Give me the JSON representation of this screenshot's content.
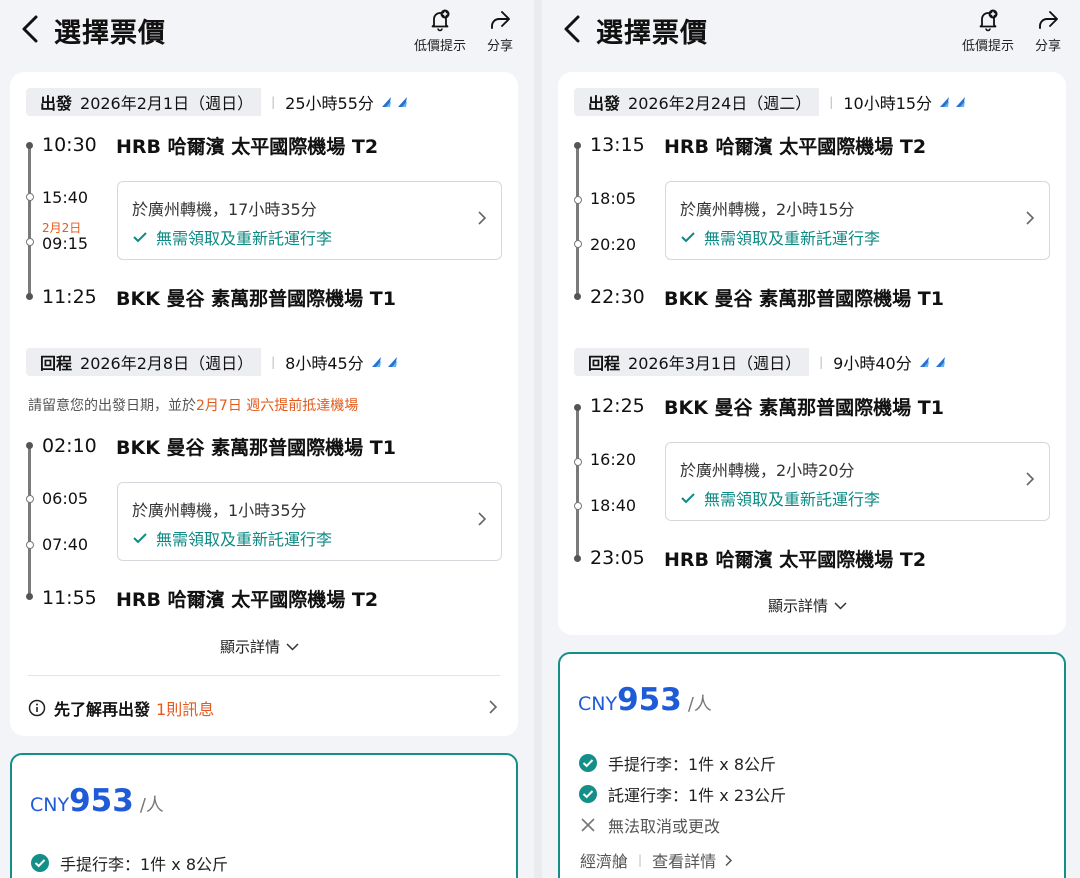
{
  "left": {
    "header": {
      "title": "選擇票價",
      "alert_label": "低價提示",
      "share_label": "分享"
    },
    "outbound": {
      "tag": "出發",
      "date": "2026年2月1日（週日）",
      "duration": "25小時55分",
      "depart_time": "10:30",
      "depart_airport": "HRB 哈爾濱 太平國際機場 T2",
      "transfer_arrive": "15:40",
      "transfer_date_change": "2月2日",
      "transfer_depart": "09:15",
      "transfer_text": "於廣州轉機，17小時35分",
      "baggage_text": "無需領取及重新託運行李",
      "arrive_time": "11:25",
      "arrive_airport": "BKK 曼谷 素萬那普國際機場 T1"
    },
    "return": {
      "tag": "回程",
      "date": "2026年2月8日（週日）",
      "duration": "8小時45分",
      "notice_pre": "請留意您的出發日期，並於",
      "notice_date": "2月7日 週六提前抵達機場",
      "depart_time": "02:10",
      "depart_airport": "BKK 曼谷 素萬那普國際機場 T1",
      "transfer_arrive": "06:05",
      "transfer_depart": "07:40",
      "transfer_text": "於廣州轉機，1小時35分",
      "baggage_text": "無需領取及重新託運行李",
      "arrive_time": "11:55",
      "arrive_airport": "HRB 哈爾濱 太平國際機場 T2"
    },
    "details_label": "顯示詳情",
    "info": {
      "label": "先了解再出發",
      "count": "1則訊息"
    },
    "price": {
      "currency": "CNY",
      "amount": "953",
      "per": "/人"
    },
    "benefits": [
      {
        "text": "手提行李：1件 x 8公斤"
      }
    ]
  },
  "right": {
    "header": {
      "title": "選擇票價",
      "alert_label": "低價提示",
      "share_label": "分享"
    },
    "outbound": {
      "tag": "出發",
      "date": "2026年2月24日（週二）",
      "duration": "10小時15分",
      "depart_time": "13:15",
      "depart_airport": "HRB 哈爾濱 太平國際機場 T2",
      "transfer_arrive": "18:05",
      "transfer_depart": "20:20",
      "transfer_text": "於廣州轉機，2小時15分",
      "baggage_text": "無需領取及重新託運行李",
      "arrive_time": "22:30",
      "arrive_airport": "BKK 曼谷 素萬那普國際機場 T1"
    },
    "return": {
      "tag": "回程",
      "date": "2026年3月1日（週日）",
      "duration": "9小時40分",
      "depart_time": "12:25",
      "depart_airport": "BKK 曼谷 素萬那普國際機場 T1",
      "transfer_arrive": "16:20",
      "transfer_depart": "18:40",
      "transfer_text": "於廣州轉機，2小時20分",
      "baggage_text": "無需領取及重新託運行李",
      "arrive_time": "23:05",
      "arrive_airport": "HRB 哈爾濱 太平國際機場 T2"
    },
    "details_label": "顯示詳情",
    "price": {
      "currency": "CNY",
      "amount": "953",
      "per": "/人"
    },
    "benefits": [
      {
        "text": "手提行李：1件 x 8公斤",
        "included": true
      },
      {
        "text": "託運行李：1件 x 23公斤",
        "included": true
      },
      {
        "text": "無法取消或更改",
        "included": false
      }
    ],
    "cabin": {
      "label": "經濟艙",
      "link": "查看詳情"
    }
  },
  "colors": {
    "accent_teal": "#148f88",
    "price_blue": "#1f5bd6",
    "warning_orange": "#e55a1a"
  },
  "icons": [
    "chevron-left-icon",
    "bell-plus-icon",
    "share-arrow-icon",
    "airline-logo-icon",
    "check-icon",
    "chevron-right-icon",
    "chevron-down-icon",
    "info-circle-icon",
    "check-circle-icon",
    "x-icon"
  ]
}
